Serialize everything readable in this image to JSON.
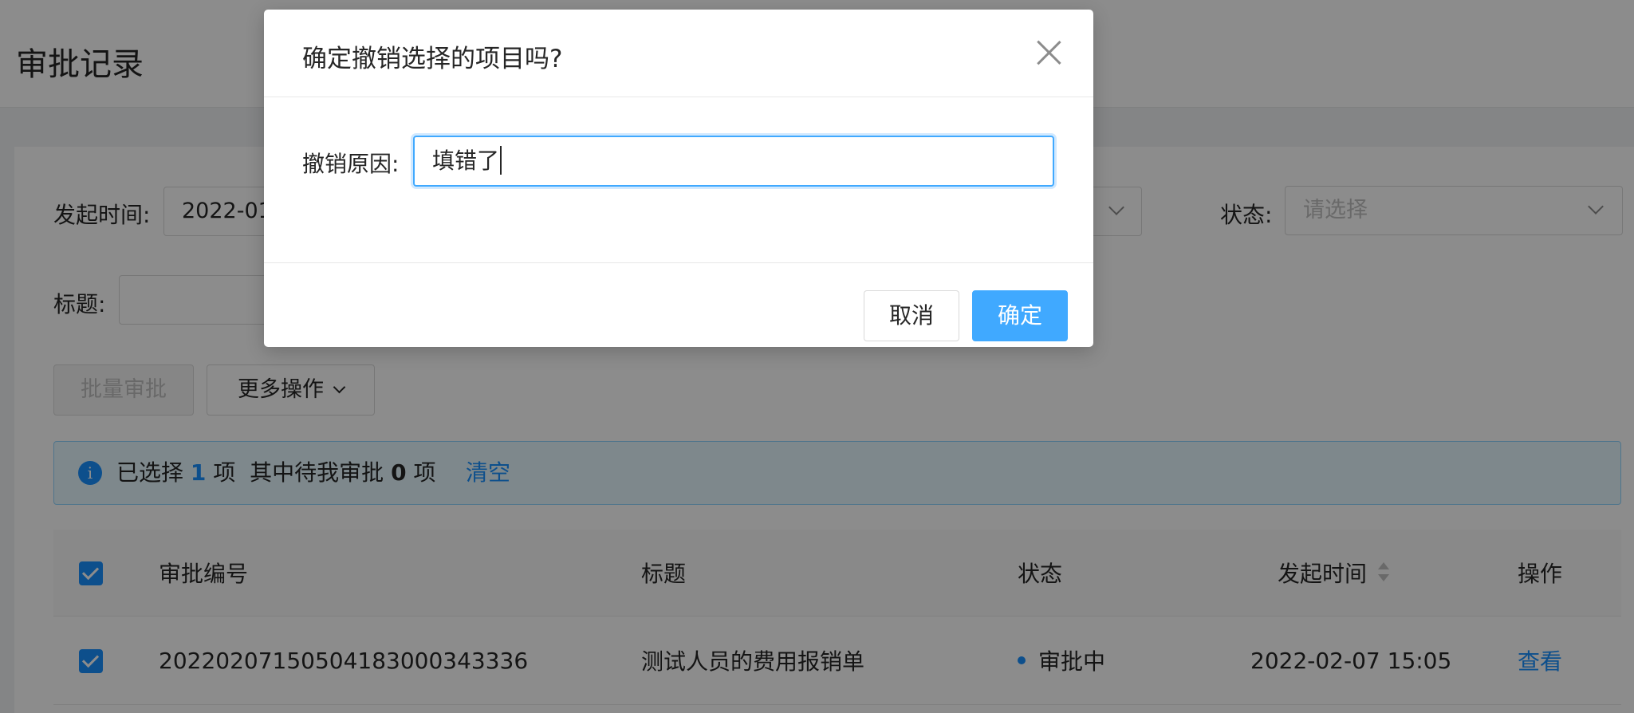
{
  "page": {
    "title": "审批记录"
  },
  "filters": {
    "start_time_label": "发起时间:",
    "start_time_value": "2022-01",
    "status_label": "状态:",
    "status_placeholder": "请选择",
    "title_label": "标题:"
  },
  "toolbar": {
    "batch_approve": "批量审批",
    "more_actions": "更多操作"
  },
  "selection": {
    "prefix": "已选择",
    "count": "1",
    "unit1": "项",
    "mid": "其中待我审批",
    "pending": "0",
    "unit2": "项",
    "clear": "清空"
  },
  "table": {
    "columns": [
      "审批编号",
      "标题",
      "状态",
      "发起时间",
      "操作"
    ],
    "rows": [
      {
        "id": "20220207150504183000343336",
        "title": "测试人员的费用报销单",
        "status": "审批中",
        "time": "2022-02-07 15:05",
        "action": "查看"
      }
    ]
  },
  "modal": {
    "title": "确定撤销选择的项目吗?",
    "reason_label": "撤销原因:",
    "reason_value": "填错了",
    "cancel": "取消",
    "ok": "确定"
  },
  "colors": {
    "primary": "#1890ff",
    "mask": "rgba(0,0,0,0.45)"
  }
}
